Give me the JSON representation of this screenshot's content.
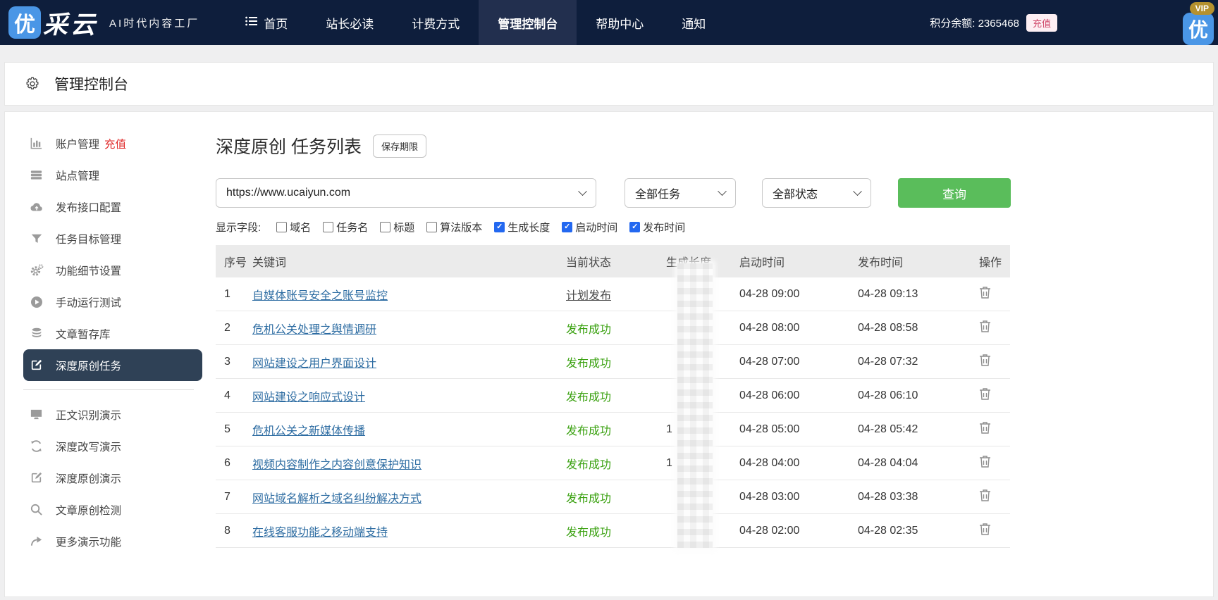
{
  "colors": {
    "nav_bg": "#0e1e3c",
    "nav_active_bg": "#222f4e",
    "brand_blue": "#4a96e6",
    "vip_gold": "#b5912e",
    "accent_green": "#5abd5b",
    "link_blue": "#2d6ca2",
    "success_green": "#3aa110",
    "danger_red": "#e02b2b",
    "sidebar_active_bg": "#2f4156"
  },
  "nav": {
    "logo_square": "优",
    "logo_text": "采云",
    "tagline": "AI时代内容工厂",
    "menu": [
      {
        "label": "首页"
      },
      {
        "label": "站长必读"
      },
      {
        "label": "计费方式"
      },
      {
        "label": "管理控制台",
        "active": true
      },
      {
        "label": "帮助中心"
      },
      {
        "label": "通知"
      }
    ],
    "points_text": "积分余额: 2365468",
    "recharge_label": "充值",
    "vip_label": "VIP",
    "vip_logo": "优"
  },
  "page_header": {
    "title": "管理控制台"
  },
  "sidebar": {
    "items": [
      {
        "label": "账户管理",
        "extra": "充值",
        "icon": "bar-chart-icon"
      },
      {
        "label": "站点管理",
        "icon": "server-icon"
      },
      {
        "label": "发布接口配置",
        "icon": "cloud-upload-icon"
      },
      {
        "label": "任务目标管理",
        "icon": "filter-icon"
      },
      {
        "label": "功能细节设置",
        "icon": "gears-icon"
      },
      {
        "label": "手动运行测试",
        "icon": "play-icon"
      },
      {
        "label": "文章暂存库",
        "icon": "database-icon"
      },
      {
        "label": "深度原创任务",
        "icon": "edit-icon",
        "active": true
      }
    ],
    "demo_items": [
      {
        "label": "正文识别演示",
        "icon": "monitor-icon"
      },
      {
        "label": "深度改写演示",
        "icon": "refresh-icon"
      },
      {
        "label": "深度原创演示",
        "icon": "edit-icon"
      },
      {
        "label": "文章原创检测",
        "icon": "search-icon"
      },
      {
        "label": "更多演示功能",
        "icon": "arrow-icon"
      }
    ]
  },
  "content": {
    "title": "深度原创 任务列表",
    "save_period_button": "保存期限",
    "filters": {
      "site": "https://www.ucaiyun.com",
      "task": "全部任务",
      "status": "全部状态",
      "query_button": "查询"
    },
    "fields_label": "显示字段:",
    "fields": [
      {
        "label": "域名",
        "checked": false
      },
      {
        "label": "任务名",
        "checked": false
      },
      {
        "label": "标题",
        "checked": false
      },
      {
        "label": "算法版本",
        "checked": false
      },
      {
        "label": "生成长度",
        "checked": true
      },
      {
        "label": "启动时间",
        "checked": true
      },
      {
        "label": "发布时间",
        "checked": true
      }
    ],
    "table": {
      "headers": [
        "序号",
        "关键词",
        "当前状态",
        "生成长度",
        "启动时间",
        "发布时间",
        "操作"
      ],
      "length_column_redacted": true,
      "rows": [
        {
          "no": "1",
          "keyword": "自媒体账号安全之账号监控",
          "status": "计划发布",
          "status_type": "planned",
          "start_time": "04-28 09:00",
          "publish_time": "04-28 09:13"
        },
        {
          "no": "2",
          "keyword": "危机公关处理之舆情调研",
          "status": "发布成功",
          "status_type": "success",
          "start_time": "04-28 08:00",
          "publish_time": "04-28 08:58"
        },
        {
          "no": "3",
          "keyword": "网站建设之用户界面设计",
          "status": "发布成功",
          "status_type": "success",
          "start_time": "04-28 07:00",
          "publish_time": "04-28 07:32"
        },
        {
          "no": "4",
          "keyword": "网站建设之响应式设计",
          "status": "发布成功",
          "status_type": "success",
          "start_time": "04-28 06:00",
          "publish_time": "04-28 06:10"
        },
        {
          "no": "5",
          "keyword": "危机公关之新媒体传播",
          "status": "发布成功",
          "status_type": "success",
          "len_hint": "1",
          "start_time": "04-28 05:00",
          "publish_time": "04-28 05:42"
        },
        {
          "no": "6",
          "keyword": "视频内容制作之内容创意保护知识",
          "status": "发布成功",
          "status_type": "success",
          "len_hint": "1",
          "start_time": "04-28 04:00",
          "publish_time": "04-28 04:04"
        },
        {
          "no": "7",
          "keyword": "网站域名解析之域名纠纷解决方式",
          "status": "发布成功",
          "status_type": "success",
          "start_time": "04-28 03:00",
          "publish_time": "04-28 03:38"
        },
        {
          "no": "8",
          "keyword": "在线客服功能之移动端支持",
          "status": "发布成功",
          "status_type": "success",
          "start_time": "04-28 02:00",
          "publish_time": "04-28 02:35"
        }
      ]
    }
  }
}
